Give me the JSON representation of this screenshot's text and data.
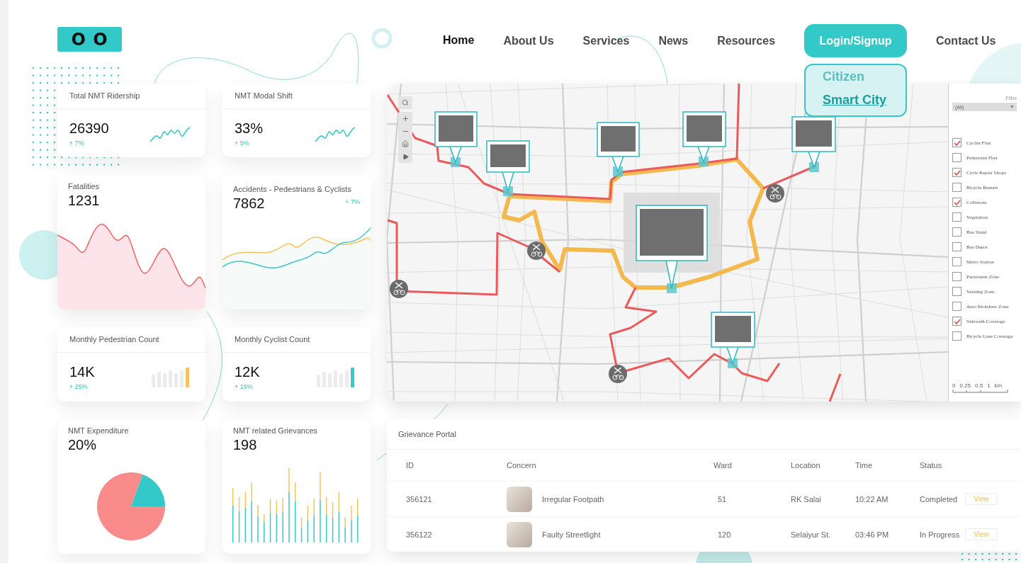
{
  "logo": {
    "text": "O O"
  },
  "nav": [
    {
      "label": "Home",
      "kind": "link",
      "selected": true
    },
    {
      "label": "About Us",
      "kind": "link",
      "selected": false
    },
    {
      "label": "Services",
      "kind": "link",
      "selected": false
    },
    {
      "label": "News",
      "kind": "link",
      "selected": false
    },
    {
      "label": "Resources",
      "kind": "link",
      "selected": false
    },
    {
      "label": "Login/Signup",
      "kind": "button",
      "selected": false,
      "expanded": true
    },
    {
      "label": "Contact Us",
      "kind": "link",
      "selected": false
    }
  ],
  "login_menu": [
    {
      "label": "Citizen",
      "selected": false
    },
    {
      "label": "Smart City",
      "selected": true
    }
  ],
  "cards": [
    {
      "kind": "sparkline",
      "title": "Total NMT Ridership",
      "value": "26390",
      "change": "+ 7%"
    },
    {
      "kind": "sparkline",
      "title": "NMT Modal Shift",
      "value": "33%",
      "change": "+ 5%"
    },
    {
      "kind": "area",
      "title": "Fatalities",
      "value": "1231"
    },
    {
      "kind": "dual-line",
      "title": "Accidents - Pedestrians & Cyclists",
      "value": "7862",
      "change": "+ 7%"
    },
    {
      "kind": "mini-bars",
      "title": "Monthly Pedestrian Count",
      "value": "14K",
      "change": "+ 25%",
      "color": "#f5c35b"
    },
    {
      "kind": "mini-bars",
      "title": "Monthly Cyclist Count",
      "value": "12K",
      "change": "+ 19%",
      "color": "#3cc9c4"
    },
    {
      "kind": "pie",
      "title": "NMT Expenditure",
      "value": "20%"
    },
    {
      "kind": "bars",
      "title": "NMT related Grievances",
      "value": "198"
    }
  ],
  "map": {
    "filter": {
      "label": "Filter",
      "select": "(All)"
    },
    "layers": [
      {
        "label": "Cyclist Flux",
        "checked": true
      },
      {
        "label": "Pedestrian Flux",
        "checked": false
      },
      {
        "label": "Cycle Repair Shops",
        "checked": true
      },
      {
        "label": "Bicycle Rentals",
        "checked": false
      },
      {
        "label": "Collisions",
        "checked": true
      },
      {
        "label": "Vegetation",
        "checked": false
      },
      {
        "label": "Bus Stand",
        "checked": false
      },
      {
        "label": "Bus Depot",
        "checked": false
      },
      {
        "label": "Metro Station",
        "checked": false
      },
      {
        "label": "Paratransit Zone",
        "checked": false
      },
      {
        "label": "Vending Zone",
        "checked": false
      },
      {
        "label": "Auto Rickshaw Zone",
        "checked": false
      },
      {
        "label": "Sidewalk Coverage",
        "checked": true
      },
      {
        "label": "Bicycle Lane Coverage",
        "checked": false
      }
    ],
    "scale": [
      "0",
      "0.25",
      "0.5",
      "1",
      "km"
    ]
  },
  "grievances": {
    "title": "Grievance Portal",
    "columns": [
      "ID",
      "Concern",
      "Ward",
      "Location",
      "Time",
      "Status"
    ],
    "rows": [
      {
        "id": "356121",
        "concern": "Irregular Footpath",
        "ward": "51",
        "location": "RK Salai",
        "time": "10:22 AM",
        "status": "Completed",
        "action": "View"
      },
      {
        "id": "356122",
        "concern": "Faulty Streetlight",
        "ward": "120",
        "location": "Selaiyur St.",
        "time": "03:46 PM",
        "status": "In Progress",
        "action": "View"
      }
    ]
  }
}
